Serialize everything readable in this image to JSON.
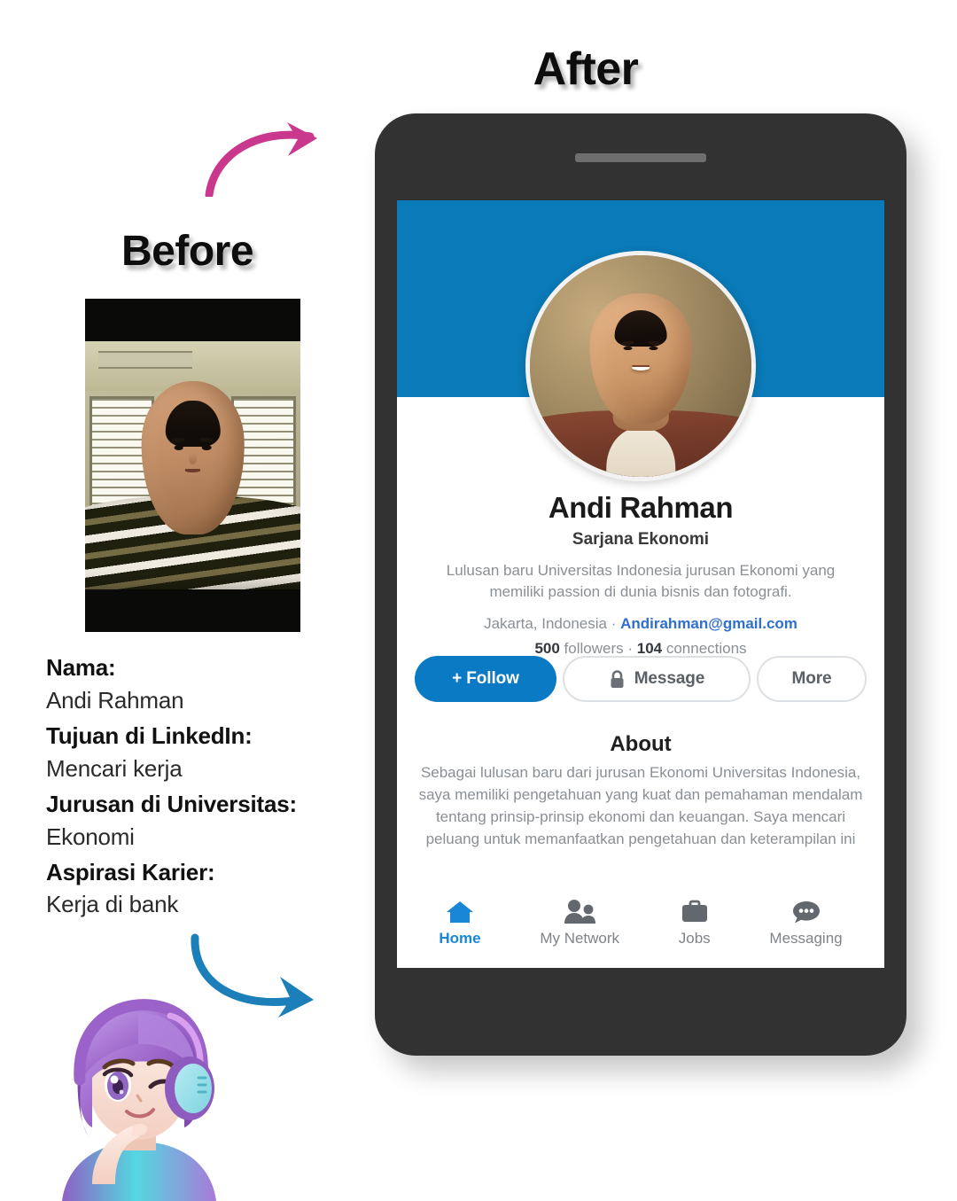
{
  "headings": {
    "before": "Before",
    "after": "After"
  },
  "before_section": {
    "photo_alt": "casual-selfie-photo",
    "fields": [
      {
        "label": "Nama:",
        "value": "Andi Rahman"
      },
      {
        "label": "Tujuan di LinkedIn:",
        "value": "Mencari kerja"
      },
      {
        "label": "Jurusan di Universitas:",
        "value": "Ekonomi"
      },
      {
        "label": "Aspirasi Karier:",
        "value": "Kerja di bank"
      }
    ]
  },
  "arrows": [
    {
      "name": "pink-curved-arrow",
      "color": "#c9388c"
    },
    {
      "name": "blue-curved-arrow",
      "color": "#1c7fba"
    }
  ],
  "mascot": {
    "name": "anime-girl-mascot",
    "hair_color": "#9b63c9",
    "headphone_color": "#7fd4e0",
    "hoodie_color": "#54d8e0"
  },
  "phone": {
    "frame_color": "#323232",
    "banner_color": "#0a7ab8",
    "profile": {
      "avatar_alt": "professional-headshot-photo",
      "name": "Andi Rahman",
      "headline": "Sarjana Ekonomi",
      "bio": "Lulusan baru Universitas Indonesia jurusan Ekonomi yang memiliki passion di dunia bisnis dan fotografi.",
      "location": "Jakarta, Indonesia",
      "separator": " · ",
      "email": "Andirahman@gmail.com",
      "followers_count": "500",
      "followers_label": " followers",
      "stats_separator": " · ",
      "connections_count": "104",
      "connections_label": " connections"
    },
    "actions": {
      "follow": "+ Follow",
      "message": "Message",
      "message_icon": "lock-icon",
      "more": "More"
    },
    "about": {
      "title": "About",
      "body": "Sebagai lulusan baru dari jurusan Ekonomi Universitas Indonesia, saya memiliki pengetahuan yang kuat dan pemahaman mendalam tentang prinsip-prinsip ekonomi dan keuangan. Saya mencari peluang untuk memanfaatkan pengetahuan dan keterampilan ini"
    },
    "nav": [
      {
        "label": "Home",
        "icon": "home-icon",
        "active": true
      },
      {
        "label": "My Network",
        "icon": "people-icon",
        "active": false
      },
      {
        "label": "Jobs",
        "icon": "briefcase-icon",
        "active": false
      },
      {
        "label": "Messaging",
        "icon": "chat-icon",
        "active": false
      }
    ]
  }
}
